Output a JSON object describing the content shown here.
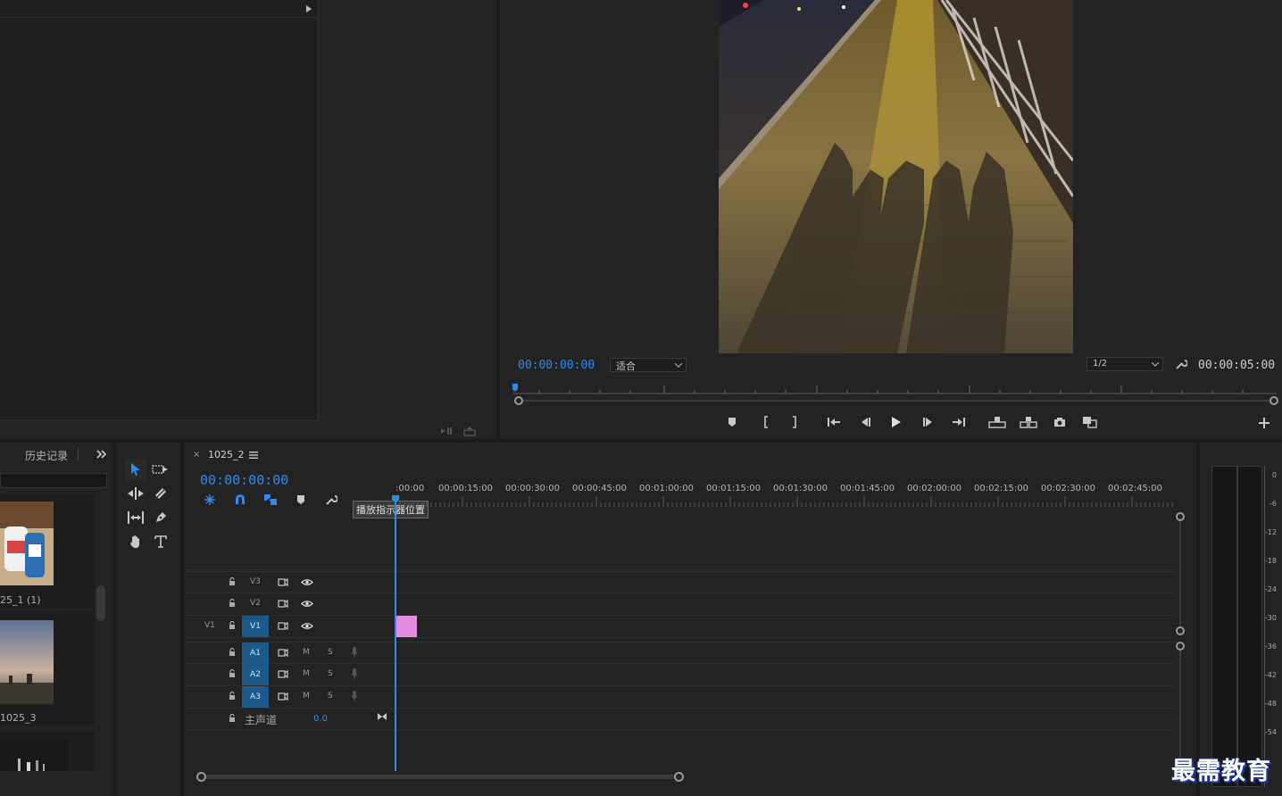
{
  "source_monitor": {
    "icons": [
      "triangle-right-icon",
      "insert-icon",
      "export-frame-icon"
    ]
  },
  "program_monitor": {
    "current_time": "00:00:00:00",
    "fit_label": "适合",
    "resolution": "1/2",
    "duration": "00:00:05:00"
  },
  "project_panel": {
    "tab_history": "历史记录",
    "items": [
      {
        "name": "25_1 (1)"
      },
      {
        "name": "1025_3"
      }
    ]
  },
  "timeline": {
    "sequence_name": "1025_2",
    "timecode": "00:00:00:00",
    "tooltip": "播放指示器位置",
    "ruler_labels": [
      ":00:00",
      "00:00:15:00",
      "00:00:30:00",
      "00:00:45:00",
      "00:01:00:00",
      "00:01:15:00",
      "00:01:30:00",
      "00:01:45:00",
      "00:02:00:00",
      "00:02:15:00",
      "00:02:30:00",
      "00:02:45:00"
    ],
    "video_tracks": [
      {
        "name": "V3",
        "source": ""
      },
      {
        "name": "V2",
        "source": ""
      },
      {
        "name": "V1",
        "source": "V1"
      }
    ],
    "audio_tracks": [
      {
        "name": "A1",
        "m": "M",
        "s": "S"
      },
      {
        "name": "A2",
        "m": "M",
        "s": "S"
      },
      {
        "name": "A3",
        "m": "M",
        "s": "S"
      }
    ],
    "master": {
      "label": "主声道",
      "value": "0.0"
    },
    "clip_color": "#e38ce0"
  },
  "audio_meter": {
    "db_labels": [
      "0",
      "-6",
      "-12",
      "-18",
      "-24",
      "-30",
      "-36",
      "-42",
      "-48",
      "-54"
    ]
  },
  "watermark": "最需教育",
  "colors": {
    "accent_blue": "#2d8ceb",
    "panel_bg": "#232323",
    "track_target": "#1d5a8a"
  }
}
